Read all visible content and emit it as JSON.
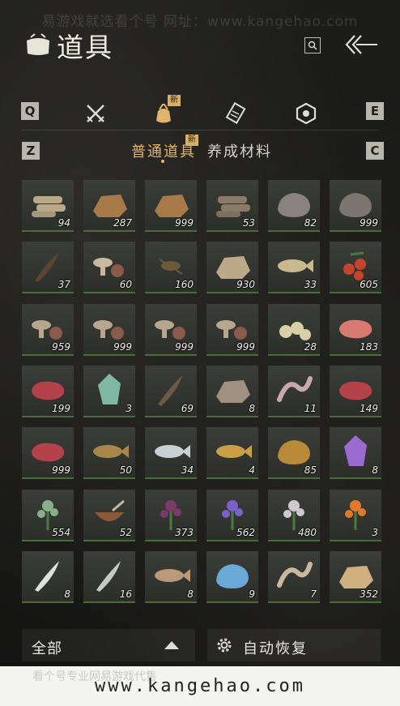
{
  "watermark_top": "易游戏就选看个号  网址：www.kangehao.com",
  "header": {
    "title": "道具"
  },
  "tabs": {
    "left_key": "Q",
    "right_key": "E",
    "new_badge": "新",
    "items": [
      {
        "icon": "crossed-swords-icon"
      },
      {
        "icon": "pouch-icon"
      },
      {
        "icon": "scroll-icon"
      },
      {
        "icon": "emblem-icon"
      }
    ]
  },
  "subtabs": {
    "left_key": "Z",
    "right_key": "C",
    "active": "普通道具",
    "inactive": "养成材料",
    "new_badge": "新"
  },
  "items": [
    {
      "name": "logs",
      "count": "94",
      "color": "#b9a98a"
    },
    {
      "name": "bark",
      "count": "287",
      "color": "#a87a4a"
    },
    {
      "name": "bark",
      "count": "999",
      "color": "#a87a4a"
    },
    {
      "name": "firewood",
      "count": "53",
      "color": "#8c7a68"
    },
    {
      "name": "stone",
      "count": "82",
      "color": "#8a827c"
    },
    {
      "name": "stone",
      "count": "999",
      "color": "#7d7670"
    },
    {
      "name": "feather",
      "count": "37",
      "color": "#5a4434"
    },
    {
      "name": "mushroom",
      "count": "60",
      "color": "#c9b8a0"
    },
    {
      "name": "insect",
      "count": "160",
      "color": "#6a5a3a"
    },
    {
      "name": "seed-sack",
      "count": "930",
      "color": "#bca98a"
    },
    {
      "name": "fish",
      "count": "33",
      "color": "#c9b890"
    },
    {
      "name": "berries",
      "count": "605",
      "color": "#c4452e"
    },
    {
      "name": "mushrooms",
      "count": "959",
      "color": "#b8a78f"
    },
    {
      "name": "mushrooms",
      "count": "999",
      "color": "#b8a78f"
    },
    {
      "name": "mushrooms",
      "count": "999",
      "color": "#b8a78f"
    },
    {
      "name": "mushrooms",
      "count": "999",
      "color": "#b8a78f"
    },
    {
      "name": "eggs",
      "count": "28",
      "color": "#d8cfa6"
    },
    {
      "name": "meat-chunks",
      "count": "183",
      "color": "#d87a72"
    },
    {
      "name": "steak",
      "count": "199",
      "color": "#b3424a"
    },
    {
      "name": "jade",
      "count": "3",
      "color": "#7fb8a4"
    },
    {
      "name": "feathers",
      "count": "69",
      "color": "#6b5a48"
    },
    {
      "name": "hide",
      "count": "8",
      "color": "#a09080"
    },
    {
      "name": "intestine",
      "count": "11",
      "color": "#c8a8b0"
    },
    {
      "name": "steak",
      "count": "149",
      "color": "#b3424a"
    },
    {
      "name": "steak",
      "count": "999",
      "color": "#b3424a"
    },
    {
      "name": "eel",
      "count": "50",
      "color": "#a8864a"
    },
    {
      "name": "fish",
      "count": "34",
      "color": "#c8d0d4"
    },
    {
      "name": "goldfish",
      "count": "4",
      "color": "#c9a046"
    },
    {
      "name": "ore",
      "count": "85",
      "color": "#b88a3a"
    },
    {
      "name": "crystal",
      "count": "8",
      "color": "#9a6ad0"
    },
    {
      "name": "herb",
      "count": "554",
      "color": "#8ab08a"
    },
    {
      "name": "bowl",
      "count": "52",
      "color": "#8a5a3a"
    },
    {
      "name": "purple-herb",
      "count": "373",
      "color": "#7a3a6a"
    },
    {
      "name": "lavender",
      "count": "562",
      "color": "#7a60c8"
    },
    {
      "name": "white-flower",
      "count": "480",
      "color": "#d0c8d0"
    },
    {
      "name": "orange-flower",
      "count": "3",
      "color": "#e07a2a"
    },
    {
      "name": "white-feather",
      "count": "8",
      "color": "#e0e0e0"
    },
    {
      "name": "needles",
      "count": "16",
      "color": "#c8c8c8"
    },
    {
      "name": "pufferfish",
      "count": "8",
      "color": "#b89a78"
    },
    {
      "name": "blue-ore",
      "count": "9",
      "color": "#6aa8d8"
    },
    {
      "name": "bone",
      "count": "7",
      "color": "#c8b8a0"
    },
    {
      "name": "bundle",
      "count": "352",
      "color": "#d0b080"
    }
  ],
  "footer": {
    "filter_label": "全部",
    "auto_label": "自动恢复"
  },
  "watermark_bottom": "www.kangehao.com",
  "watermark_bottom_faint": "看个号专业网易游戏代售 "
}
